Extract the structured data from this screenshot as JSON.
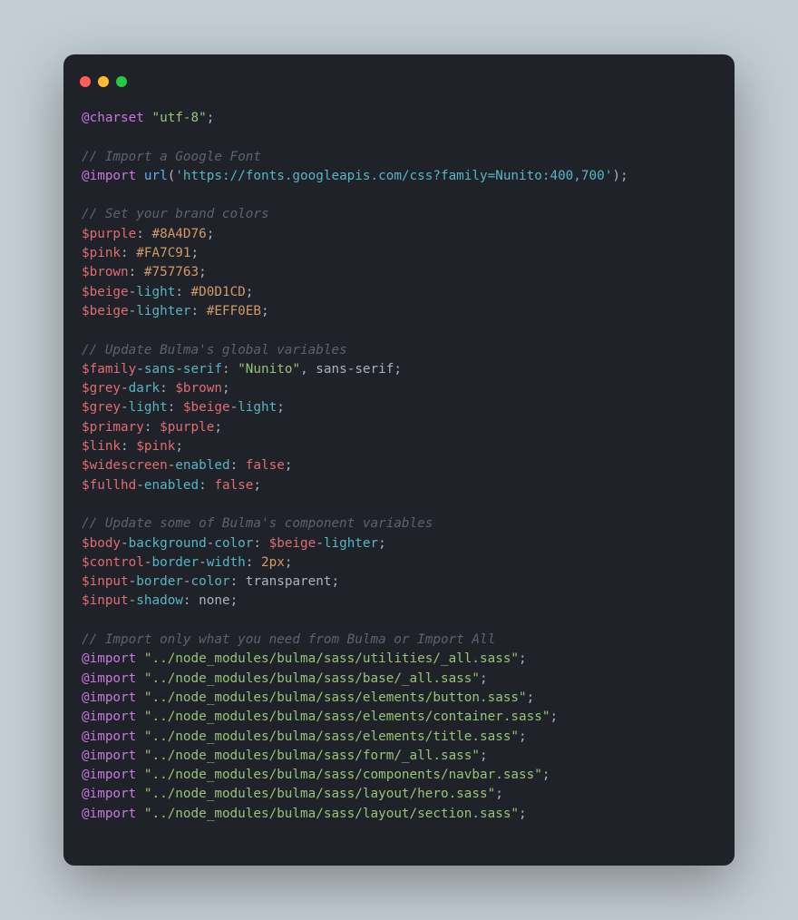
{
  "colors": {
    "bg_page": "#c4cdd4",
    "bg_window": "#1f2229",
    "traffic_red": "#ff5f56",
    "traffic_yellow": "#ffbd2e",
    "traffic_green": "#27c93f",
    "token_atrule": "#c678dd",
    "token_comment": "#5c6370",
    "token_variable": "#e06c75",
    "token_string": "#98c379",
    "token_url": "#56b6c2",
    "token_function": "#61afef",
    "token_number": "#d19a66",
    "token_default": "#abb2bf"
  },
  "code": {
    "language": "scss",
    "lines": [
      [
        [
          "at",
          "@charset"
        ],
        [
          "punc",
          " "
        ],
        [
          "str",
          "\"utf-8\""
        ],
        [
          "punc",
          ";"
        ]
      ],
      [],
      [
        [
          "comment",
          "// Import a Google Font"
        ]
      ],
      [
        [
          "at",
          "@import"
        ],
        [
          "punc",
          " "
        ],
        [
          "fn",
          "url"
        ],
        [
          "punc",
          "("
        ],
        [
          "url",
          "'https://fonts.googleapis.com/css?family=Nunito:400,700'"
        ],
        [
          "punc",
          ");"
        ]
      ],
      [],
      [
        [
          "comment",
          "// Set your brand colors"
        ]
      ],
      [
        [
          "var",
          "$purple"
        ],
        [
          "punc",
          ": "
        ],
        [
          "num",
          "#8A4D76"
        ],
        [
          "punc",
          ";"
        ]
      ],
      [
        [
          "var",
          "$pink"
        ],
        [
          "punc",
          ": "
        ],
        [
          "num",
          "#FA7C91"
        ],
        [
          "punc",
          ";"
        ]
      ],
      [
        [
          "var",
          "$brown"
        ],
        [
          "punc",
          ": "
        ],
        [
          "num",
          "#757763"
        ],
        [
          "punc",
          ";"
        ]
      ],
      [
        [
          "var",
          "$beige"
        ],
        [
          "punc",
          "-"
        ],
        [
          "key",
          "light"
        ],
        [
          "punc",
          ": "
        ],
        [
          "num",
          "#D0D1CD"
        ],
        [
          "punc",
          ";"
        ]
      ],
      [
        [
          "var",
          "$beige"
        ],
        [
          "punc",
          "-"
        ],
        [
          "key",
          "lighter"
        ],
        [
          "punc",
          ": "
        ],
        [
          "num",
          "#EFF0EB"
        ],
        [
          "punc",
          ";"
        ]
      ],
      [],
      [
        [
          "comment",
          "// Update Bulma's global variables"
        ]
      ],
      [
        [
          "var",
          "$family"
        ],
        [
          "punc",
          "-"
        ],
        [
          "key",
          "sans"
        ],
        [
          "punc",
          "-"
        ],
        [
          "key",
          "serif"
        ],
        [
          "punc",
          ": "
        ],
        [
          "str",
          "\"Nunito\""
        ],
        [
          "punc",
          ", "
        ],
        [
          "ident",
          "sans"
        ],
        [
          "punc",
          "-"
        ],
        [
          "ident",
          "serif"
        ],
        [
          "punc",
          ";"
        ]
      ],
      [
        [
          "var",
          "$grey"
        ],
        [
          "punc",
          "-"
        ],
        [
          "key",
          "dark"
        ],
        [
          "punc",
          ": "
        ],
        [
          "var",
          "$brown"
        ],
        [
          "punc",
          ";"
        ]
      ],
      [
        [
          "var",
          "$grey"
        ],
        [
          "punc",
          "-"
        ],
        [
          "key",
          "light"
        ],
        [
          "punc",
          ": "
        ],
        [
          "var",
          "$beige"
        ],
        [
          "punc",
          "-"
        ],
        [
          "key",
          "light"
        ],
        [
          "punc",
          ";"
        ]
      ],
      [
        [
          "var",
          "$primary"
        ],
        [
          "punc",
          ": "
        ],
        [
          "var",
          "$purple"
        ],
        [
          "punc",
          ";"
        ]
      ],
      [
        [
          "var",
          "$link"
        ],
        [
          "punc",
          ": "
        ],
        [
          "var",
          "$pink"
        ],
        [
          "punc",
          ";"
        ]
      ],
      [
        [
          "var",
          "$widescreen"
        ],
        [
          "punc",
          "-"
        ],
        [
          "key",
          "enabled"
        ],
        [
          "punc",
          ": "
        ],
        [
          "kw",
          "false"
        ],
        [
          "punc",
          ";"
        ]
      ],
      [
        [
          "var",
          "$fullhd"
        ],
        [
          "punc",
          "-"
        ],
        [
          "key",
          "enabled"
        ],
        [
          "punc",
          ": "
        ],
        [
          "kw",
          "false"
        ],
        [
          "punc",
          ";"
        ]
      ],
      [],
      [
        [
          "comment",
          "// Update some of Bulma's component variables"
        ]
      ],
      [
        [
          "var",
          "$body"
        ],
        [
          "punc",
          "-"
        ],
        [
          "key",
          "background"
        ],
        [
          "punc",
          "-"
        ],
        [
          "key",
          "color"
        ],
        [
          "punc",
          ": "
        ],
        [
          "var",
          "$beige"
        ],
        [
          "punc",
          "-"
        ],
        [
          "key",
          "lighter"
        ],
        [
          "punc",
          ";"
        ]
      ],
      [
        [
          "var",
          "$control"
        ],
        [
          "punc",
          "-"
        ],
        [
          "key",
          "border"
        ],
        [
          "punc",
          "-"
        ],
        [
          "key",
          "width"
        ],
        [
          "punc",
          ": "
        ],
        [
          "num",
          "2px"
        ],
        [
          "punc",
          ";"
        ]
      ],
      [
        [
          "var",
          "$input"
        ],
        [
          "punc",
          "-"
        ],
        [
          "key",
          "border"
        ],
        [
          "punc",
          "-"
        ],
        [
          "key",
          "color"
        ],
        [
          "punc",
          ": "
        ],
        [
          "ident",
          "transparent"
        ],
        [
          "punc",
          ";"
        ]
      ],
      [
        [
          "var",
          "$input"
        ],
        [
          "punc",
          "-"
        ],
        [
          "key",
          "shadow"
        ],
        [
          "punc",
          ": "
        ],
        [
          "ident",
          "none"
        ],
        [
          "punc",
          ";"
        ]
      ],
      [],
      [
        [
          "comment",
          "// Import only what you need from Bulma or Import All"
        ]
      ],
      [
        [
          "at",
          "@import"
        ],
        [
          "punc",
          " "
        ],
        [
          "str",
          "\"../node_modules/bulma/sass/utilities/_all.sass\""
        ],
        [
          "punc",
          ";"
        ]
      ],
      [
        [
          "at",
          "@import"
        ],
        [
          "punc",
          " "
        ],
        [
          "str",
          "\"../node_modules/bulma/sass/base/_all.sass\""
        ],
        [
          "punc",
          ";"
        ]
      ],
      [
        [
          "at",
          "@import"
        ],
        [
          "punc",
          " "
        ],
        [
          "str",
          "\"../node_modules/bulma/sass/elements/button.sass\""
        ],
        [
          "punc",
          ";"
        ]
      ],
      [
        [
          "at",
          "@import"
        ],
        [
          "punc",
          " "
        ],
        [
          "str",
          "\"../node_modules/bulma/sass/elements/container.sass\""
        ],
        [
          "punc",
          ";"
        ]
      ],
      [
        [
          "at",
          "@import"
        ],
        [
          "punc",
          " "
        ],
        [
          "str",
          "\"../node_modules/bulma/sass/elements/title.sass\""
        ],
        [
          "punc",
          ";"
        ]
      ],
      [
        [
          "at",
          "@import"
        ],
        [
          "punc",
          " "
        ],
        [
          "str",
          "\"../node_modules/bulma/sass/form/_all.sass\""
        ],
        [
          "punc",
          ";"
        ]
      ],
      [
        [
          "at",
          "@import"
        ],
        [
          "punc",
          " "
        ],
        [
          "str",
          "\"../node_modules/bulma/sass/components/navbar.sass\""
        ],
        [
          "punc",
          ";"
        ]
      ],
      [
        [
          "at",
          "@import"
        ],
        [
          "punc",
          " "
        ],
        [
          "str",
          "\"../node_modules/bulma/sass/layout/hero.sass\""
        ],
        [
          "punc",
          ";"
        ]
      ],
      [
        [
          "at",
          "@import"
        ],
        [
          "punc",
          " "
        ],
        [
          "str",
          "\"../node_modules/bulma/sass/layout/section.sass\""
        ],
        [
          "punc",
          ";"
        ]
      ]
    ]
  }
}
